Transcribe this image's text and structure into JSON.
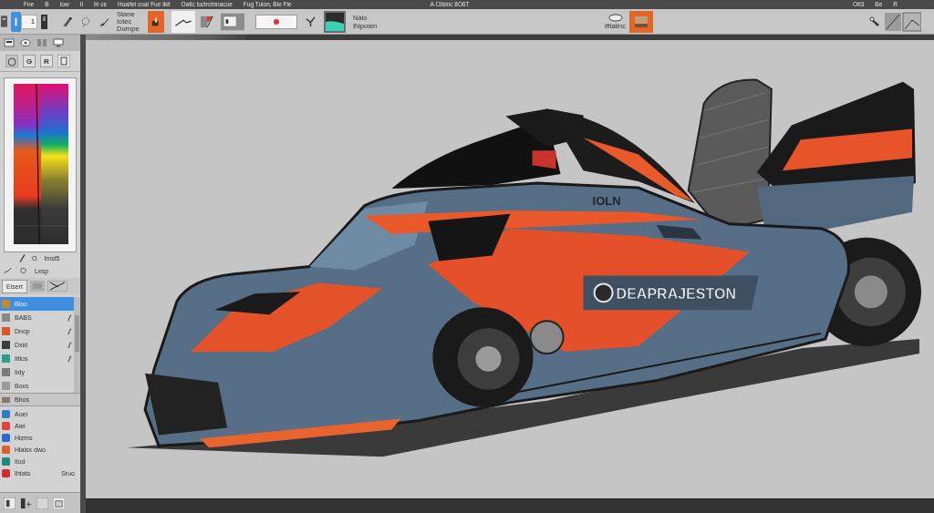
{
  "menu_bar": {
    "items": [
      "Fne",
      "B",
      "Iow",
      "Il",
      "Iri ce",
      "Hoaitel coa/ Fue Ikit",
      "Oatic Iuctrotnnacue",
      "Fug Tulon, Ble Fie"
    ],
    "title": "A Cilsinc 8O6T",
    "right_items": [
      "OIt3",
      "Be",
      "R"
    ]
  },
  "toolbar": {
    "tools": [
      {
        "selected": true
      },
      {
        "selected": false
      },
      {
        "selected": false
      },
      {
        "selected": false
      }
    ],
    "size_value": "1",
    "option_text": "Stane Iotec Durnpe",
    "brushes": [
      {
        "selected": true
      },
      {
        "selected": false
      },
      {
        "selected": false
      },
      {
        "selected": false
      }
    ],
    "info_text": "Naio Ihipoien",
    "preset_label": "ifitaiinc",
    "preset": {
      "selected": true
    }
  },
  "left_panel": {
    "tool_buttons": [
      "G",
      "R"
    ],
    "color_label": "O.",
    "color_value": "Imst5",
    "brush_label": "Lesp",
    "tab": "Eisert",
    "layers": [
      {
        "name": "Bloo",
        "color": "#c8862e",
        "selected": true,
        "linked": false
      },
      {
        "name": "BABS",
        "color": "#8a8a8a",
        "selected": false,
        "linked": true
      },
      {
        "name": "Dnop",
        "color": "#e0522a",
        "selected": false,
        "linked": true
      },
      {
        "name": "Dxid",
        "color": "#3c3c3c",
        "selected": false,
        "linked": true
      },
      {
        "name": "Iitlos",
        "color": "#2aa08c",
        "selected": false,
        "linked": true
      },
      {
        "name": "Iidy",
        "color": "#7a7a7a",
        "selected": false,
        "linked": false
      },
      {
        "name": "Bovs",
        "color": "#9a9a9a",
        "selected": false,
        "linked": false
      }
    ],
    "group_title": "Bhos",
    "objects": [
      {
        "name": "Aoei",
        "color": "#2f7fc8"
      },
      {
        "name": "Aiei",
        "color": "#e0443a"
      },
      {
        "name": "Hizms",
        "color": "#2a6ad0"
      },
      {
        "name": "Hlaisx dwo",
        "color": "#d8622a"
      },
      {
        "name": "Ilod",
        "color": "#1f8a78"
      },
      {
        "name": "Ihtato",
        "color": "#d02a3a",
        "note": "Sruo"
      }
    ]
  },
  "canvas": {
    "decal_text": "IOLN",
    "livery_text": "DEAPRAJESTON"
  }
}
